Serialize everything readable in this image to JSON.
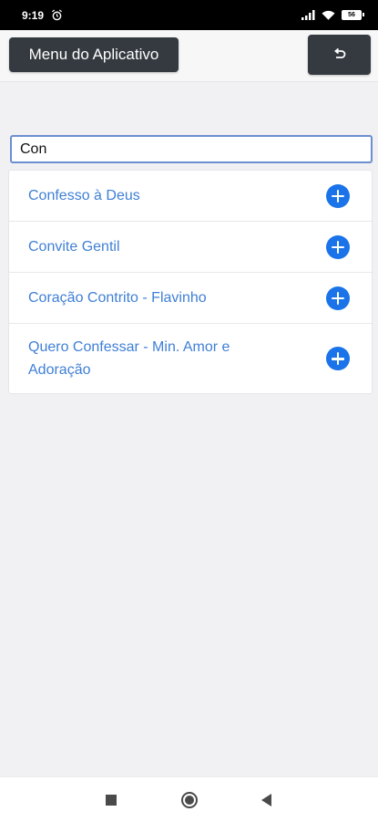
{
  "status_bar": {
    "time": "9:19",
    "battery": "56"
  },
  "header": {
    "menu_label": "Menu do Aplicativo"
  },
  "search": {
    "value": "Con"
  },
  "results": [
    {
      "title": "Confesso à Deus"
    },
    {
      "title": "Convite Gentil"
    },
    {
      "title": "Coração Contrito - Flavinho"
    },
    {
      "title": "Quero Confessar - Min. Amor e Adoração"
    }
  ],
  "colors": {
    "accent": "#1a73e8",
    "link_text": "#3f7fd6",
    "header_button_bg": "#353a40"
  },
  "icons": {
    "add": "plus-circle-icon",
    "back": "undo-icon",
    "nav": [
      "square-icon",
      "home-circle-icon",
      "back-triangle-icon"
    ]
  }
}
